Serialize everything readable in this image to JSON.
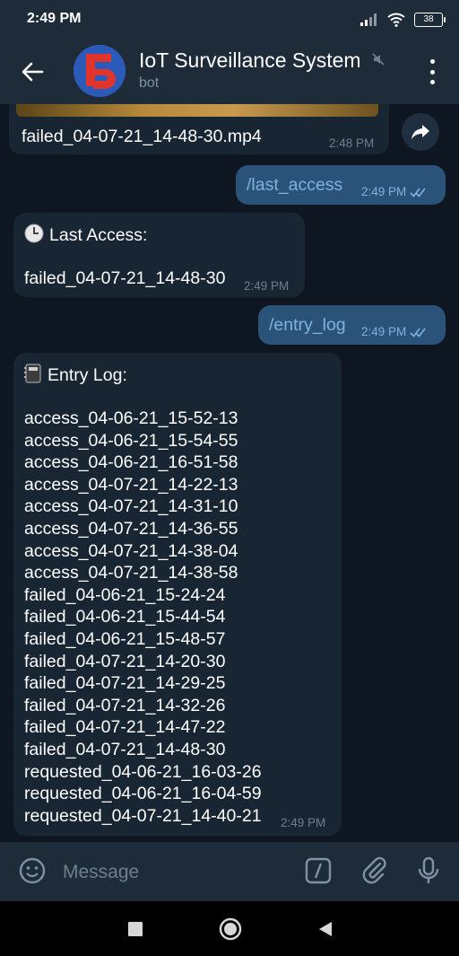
{
  "status": {
    "time": "2:49 PM",
    "battery": "38"
  },
  "chat_header": {
    "title": "IoT Surveillance System",
    "subtitle": "bot"
  },
  "messages": {
    "video": {
      "filename": "failed_04-07-21_14-48-30.mp4",
      "time": "2:48 PM"
    },
    "cmd_last_access": {
      "text": "/last_access",
      "time": "2:49 PM"
    },
    "last_access": {
      "heading": "Last Access:",
      "value": "failed_04-07-21_14-48-30",
      "time": "2:49 PM"
    },
    "cmd_entry_log": {
      "text": "/entry_log",
      "time": "2:49 PM"
    },
    "entry_log": {
      "heading": "Entry Log:",
      "entries": [
        "access_04-06-21_15-52-13",
        "access_04-06-21_15-54-55",
        "access_04-06-21_16-51-58",
        "access_04-07-21_14-22-13",
        "access_04-07-21_14-31-10",
        "access_04-07-21_14-36-55",
        "access_04-07-21_14-38-04",
        "access_04-07-21_14-38-58",
        "failed_04-06-21_15-24-24",
        "failed_04-06-21_15-44-54",
        "failed_04-06-21_15-48-57",
        "failed_04-07-21_14-20-30",
        "failed_04-07-21_14-29-25",
        "failed_04-07-21_14-32-26",
        "failed_04-07-21_14-47-22",
        "failed_04-07-21_14-48-30",
        "requested_04-06-21_16-03-26",
        "requested_04-06-21_16-04-59",
        "requested_04-07-21_14-40-21"
      ],
      "time": "2:49 PM"
    }
  },
  "composer": {
    "placeholder": "Message"
  },
  "colors": {
    "background": "#0e1621",
    "header": "#1e2c3a",
    "incoming_bubble": "#182533",
    "outgoing_bubble": "#2b5278",
    "accent": "#7fb2e0"
  }
}
